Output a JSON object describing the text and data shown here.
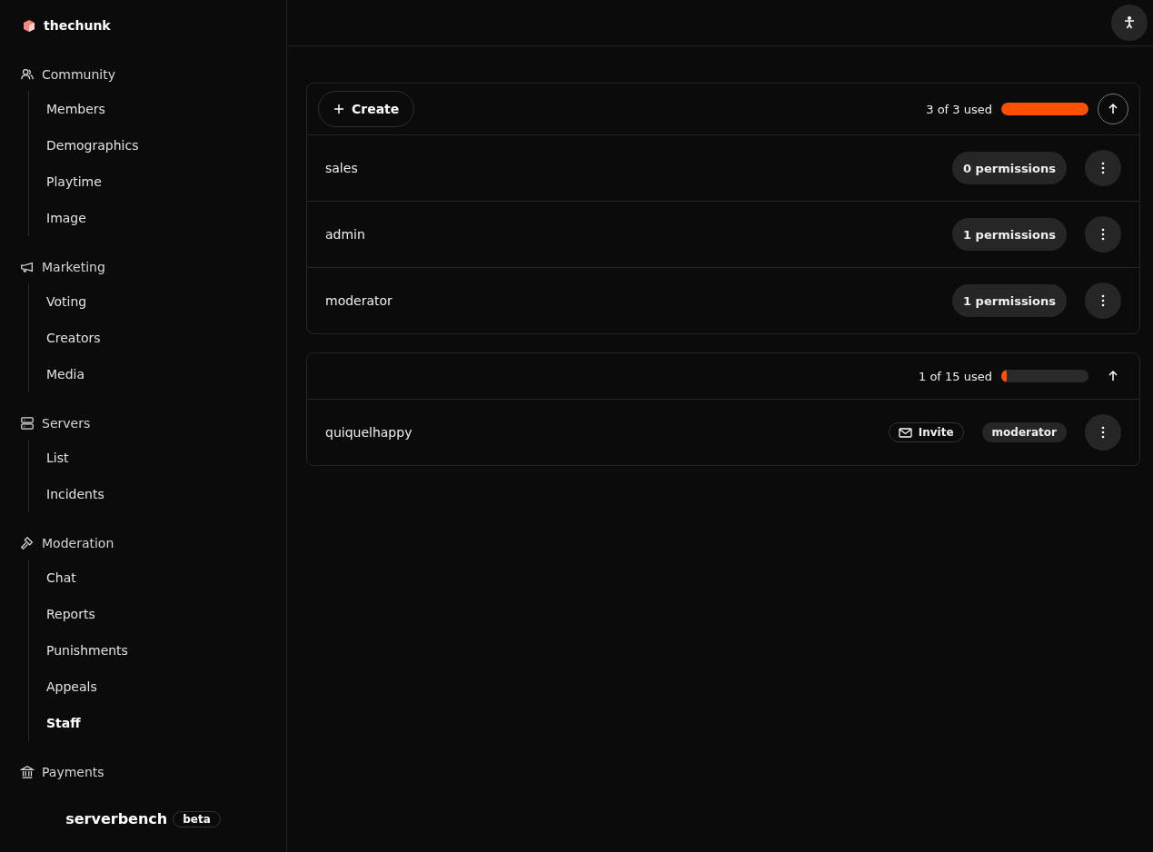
{
  "brand": {
    "name": "thechunk"
  },
  "sidebar": {
    "sections": [
      {
        "label": "Community",
        "items": [
          {
            "label": "Members",
            "selected": false
          },
          {
            "label": "Demographics",
            "selected": false
          },
          {
            "label": "Playtime",
            "selected": false
          },
          {
            "label": "Image",
            "selected": false
          }
        ]
      },
      {
        "label": "Marketing",
        "items": [
          {
            "label": "Voting",
            "selected": false
          },
          {
            "label": "Creators",
            "selected": false
          },
          {
            "label": "Media",
            "selected": false
          }
        ]
      },
      {
        "label": "Servers",
        "items": [
          {
            "label": "List",
            "selected": false
          },
          {
            "label": "Incidents",
            "selected": false
          }
        ]
      },
      {
        "label": "Moderation",
        "items": [
          {
            "label": "Chat",
            "selected": false
          },
          {
            "label": "Reports",
            "selected": false
          },
          {
            "label": "Punishments",
            "selected": false
          },
          {
            "label": "Appeals",
            "selected": false
          },
          {
            "label": "Staff",
            "selected": true
          }
        ]
      },
      {
        "label": "Payments"
      }
    ]
  },
  "footer": {
    "product": "serverbench",
    "badge": "beta"
  },
  "roles_card": {
    "create_button": "Create",
    "usage": "3 of 3 used",
    "level": 1.0,
    "rows": [
      {
        "name": "sales",
        "permissions": "0 permissions"
      },
      {
        "name": "admin",
        "permissions": "1 permissions"
      },
      {
        "name": "moderator",
        "permissions": "1 permissions"
      }
    ]
  },
  "staff_card": {
    "usage": "1 of 15 used",
    "level": 0.067,
    "rows": [
      {
        "name": "quiquelhappy",
        "invite": "Invite",
        "role": "moderator"
      }
    ]
  }
}
